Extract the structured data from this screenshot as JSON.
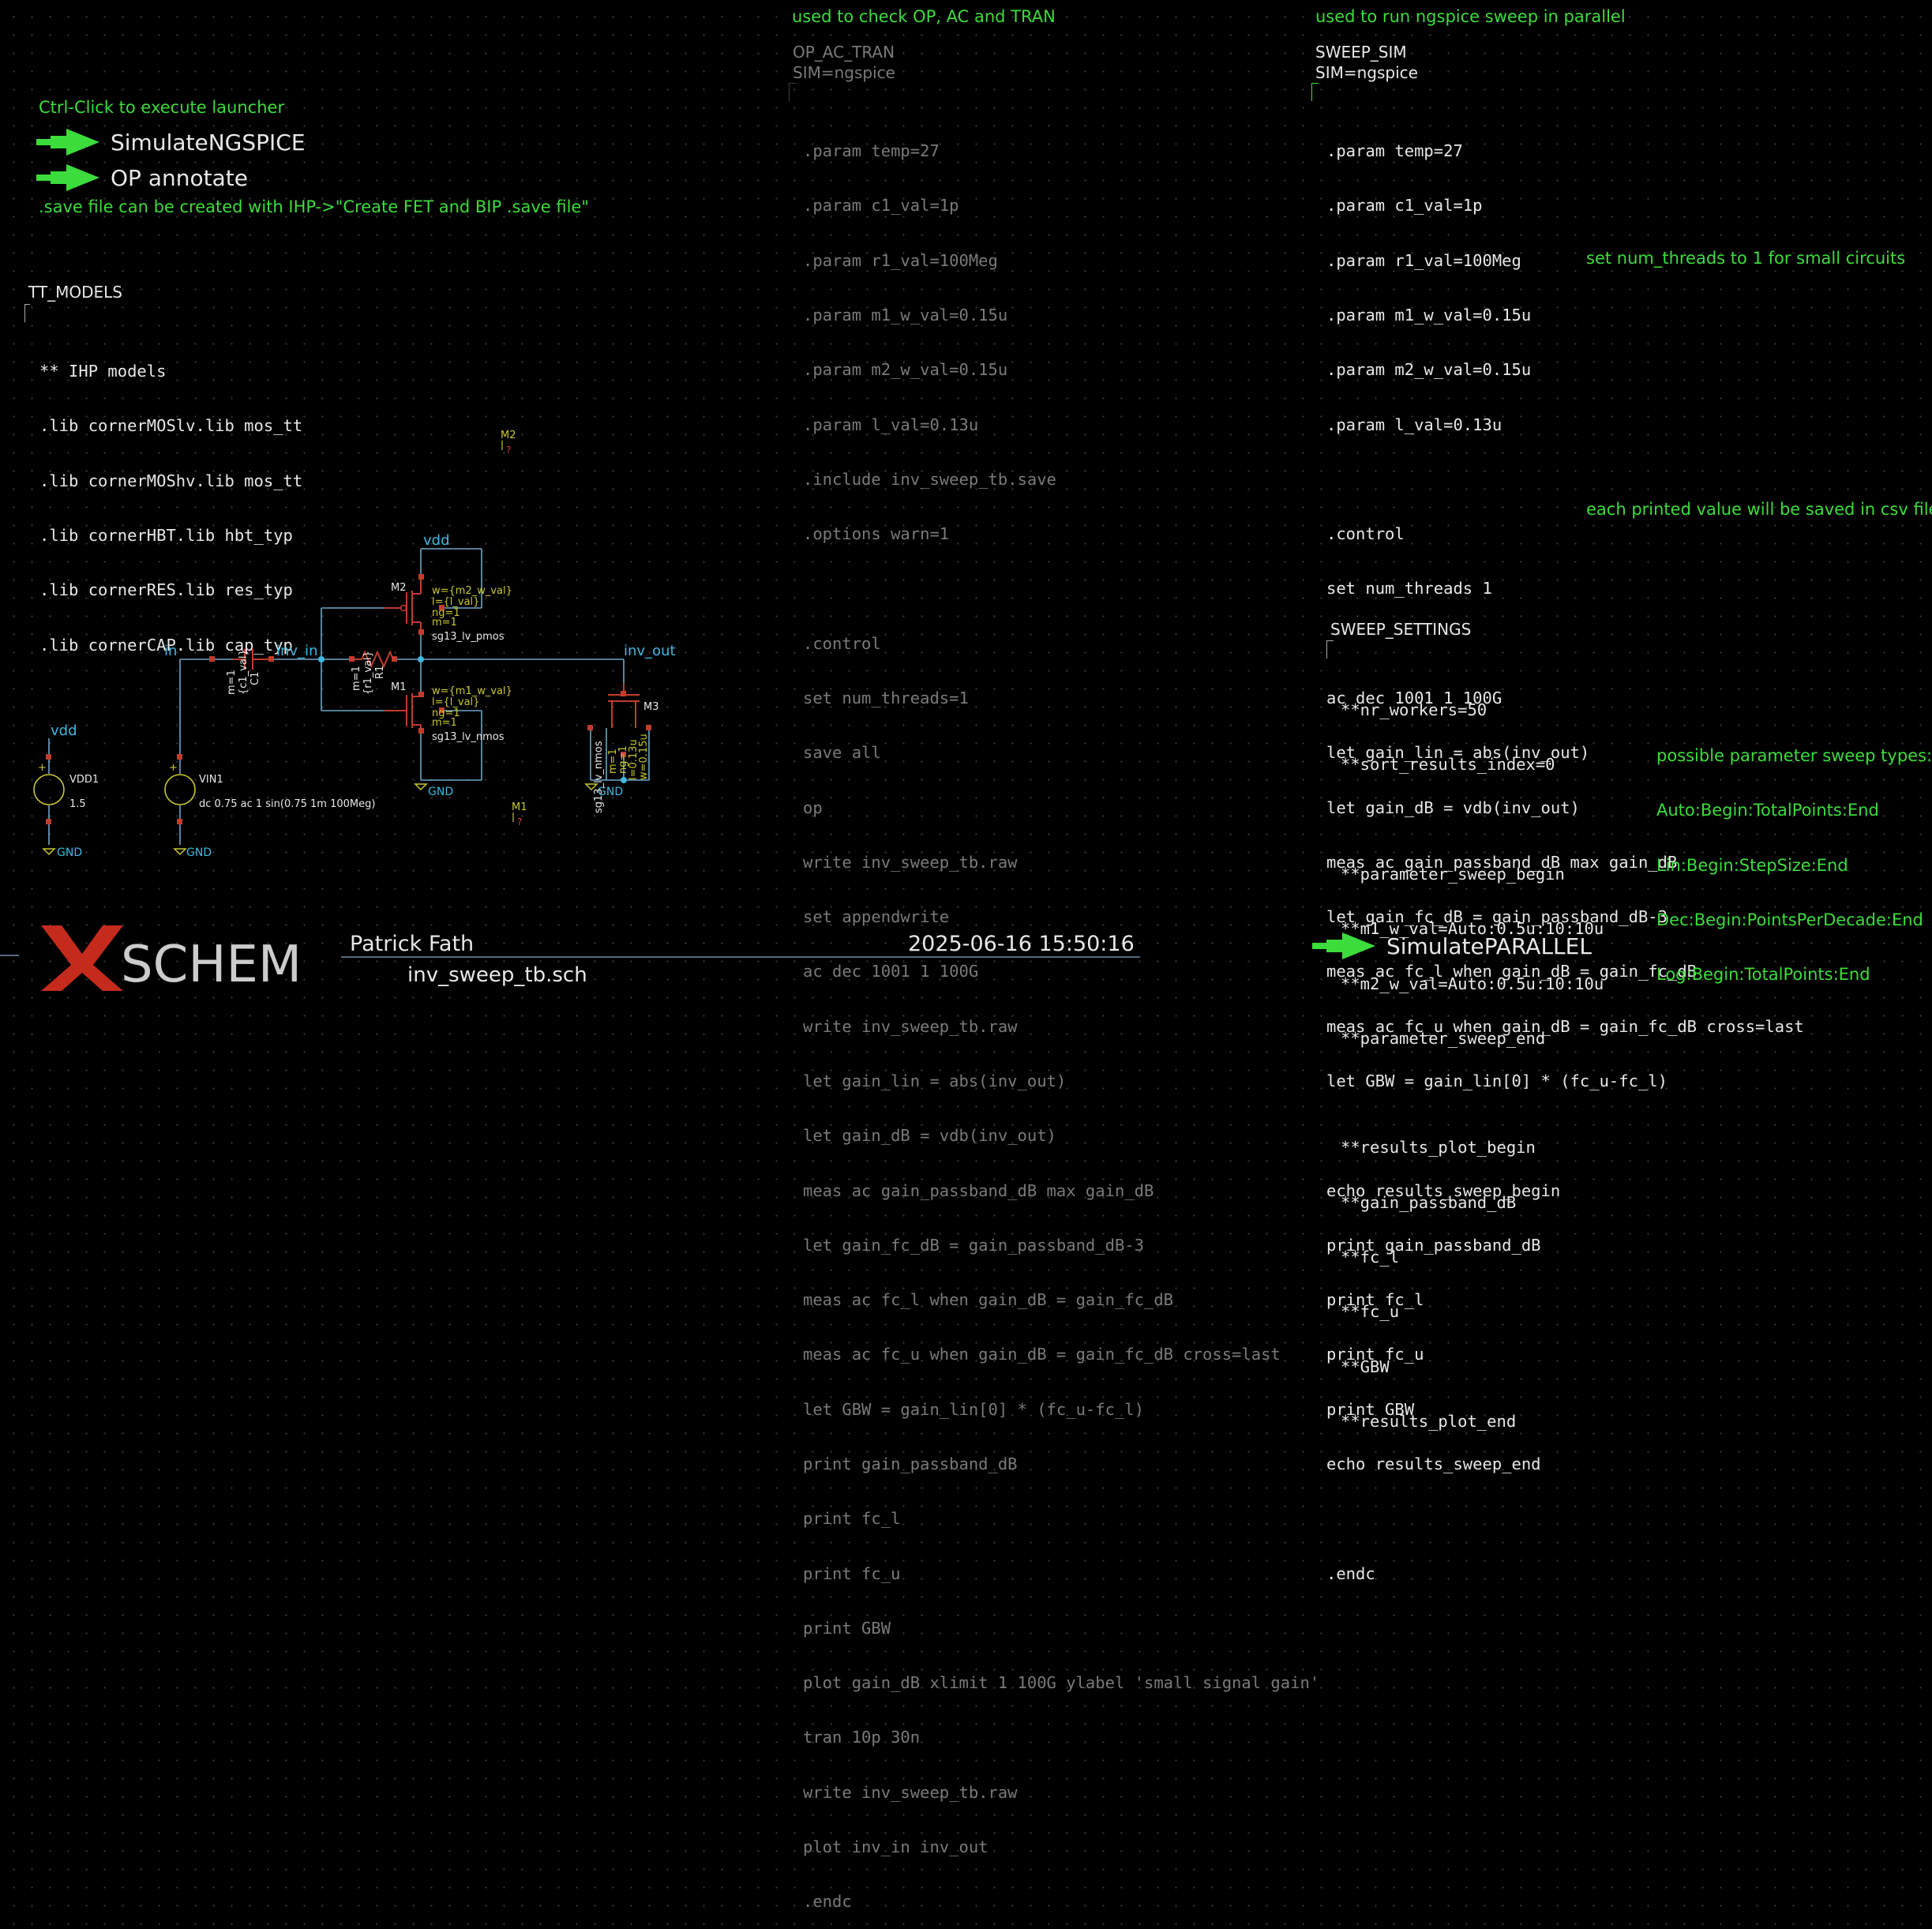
{
  "header_notes": {
    "op_note": "used to check OP, AC and TRAN",
    "sweep_note": "used to run ngspice sweep in parallel"
  },
  "launchers": {
    "hint": "Ctrl-Click to execute launcher",
    "simulate_ngspice": "SimulateNGSPICE",
    "op_annotate": "OP annotate",
    "save_note": ".save file can be created with IHP->\"Create FET and BIP .save file\"",
    "simulate_parallel": "SimulatePARALLEL"
  },
  "tt_models": {
    "title": "TT_MODELS",
    "lines": [
      "** IHP models",
      ".lib cornerMOSlv.lib mos_tt",
      ".lib cornerMOShv.lib mos_tt",
      ".lib cornerHBT.lib hbt_typ",
      ".lib cornerRES.lib res_typ",
      ".lib cornerCAP.lib cap_typ"
    ]
  },
  "op_ac_tran": {
    "title": "OP_AC_TRAN",
    "sim": "SIM=ngspice",
    "lines": [
      ".param temp=27",
      ".param c1_val=1p",
      ".param r1_val=100Meg",
      ".param m1_w_val=0.15u",
      ".param m2_w_val=0.15u",
      ".param l_val=0.13u",
      ".include inv_sweep_tb.save",
      ".options warn=1",
      "",
      ".control",
      "set num_threads=1",
      "save all",
      "op",
      "write inv_sweep_tb.raw",
      "set appendwrite",
      "ac dec 1001 1 100G",
      "write inv_sweep_tb.raw",
      "let gain_lin = abs(inv_out)",
      "let gain_dB = vdb(inv_out)",
      "meas ac gain_passband_dB max gain_dB",
      "let gain_fc_dB = gain_passband_dB-3",
      "meas ac fc_l when gain_dB = gain_fc_dB",
      "meas ac fc_u when gain_dB = gain_fc_dB cross=last",
      "let GBW = gain_lin[0] * (fc_u-fc_l)",
      "print gain_passband_dB",
      "print fc_l",
      "print fc_u",
      "print GBW",
      "plot gain_dB xlimit 1 100G ylabel 'small signal gain'",
      "tran 10p 30n",
      "write inv_sweep_tb.raw",
      "plot inv_in inv_out",
      ".endc"
    ]
  },
  "sweep_sim": {
    "title": "SWEEP_SIM",
    "sim": "SIM=ngspice",
    "lines": [
      ".param temp=27",
      ".param c1_val=1p",
      ".param r1_val=100Meg",
      ".param m1_w_val=0.15u",
      ".param m2_w_val=0.15u",
      ".param l_val=0.13u",
      "",
      ".control",
      "set num_threads 1",
      "",
      "ac dec 1001 1 100G",
      "let gain_lin = abs(inv_out)",
      "let gain_dB = vdb(inv_out)",
      "meas ac gain_passband_dB max gain_dB",
      "let gain_fc_dB = gain_passband_dB-3",
      "meas ac fc_l when gain_dB = gain_fc_dB",
      "meas ac fc_u when gain_dB = gain_fc_dB cross=last",
      "let GBW = gain_lin[0] * (fc_u-fc_l)",
      "",
      "echo results_sweep_begin",
      "print gain_passband_dB",
      "print fc_l",
      "print fc_u",
      "print GBW",
      "echo results_sweep_end",
      "",
      ".endc"
    ],
    "note_threads": "set num_threads to 1 for small circuits",
    "note_csv": "each printed value will be saved in csv file"
  },
  "sweep_settings": {
    "title": "SWEEP_SETTINGS",
    "lines": [
      "**nr_workers=50",
      "**sort_results_index=0",
      "",
      "**parameter_sweep_begin",
      "**m1_w_val=Auto:0.5u:10:10u",
      "**m2_w_val=Auto:0.5u:10:10u",
      "**parameter_sweep_end",
      "",
      "**results_plot_begin",
      "**gain_passband_dB",
      "**fc_l",
      "**fc_u",
      "**GBW",
      "**results_plot_end"
    ],
    "types_note": [
      "possible parameter sweep types:",
      "Auto:Begin:TotalPoints:End",
      "Lin:Begin:StepSize:End",
      "Dec:Begin:PointsPerDecade:End",
      "Log:Begin:TotalPoints:End"
    ]
  },
  "schematic": {
    "nets": {
      "vdd_top": "vdd",
      "in": "in",
      "inv_in": "inv_in",
      "inv_out": "inv_out",
      "vdd_left": "vdd",
      "gnd": "GND"
    },
    "m2": {
      "name": "M2",
      "w": "w={m2_w_val}",
      "l": "l={l_val}",
      "ng": "ng=1",
      "m": "m=1",
      "model": "sg13_lv_pmos"
    },
    "m1": {
      "name": "M1",
      "w": "w={m1_w_val}",
      "l": "l={l_val}",
      "ng": "ng=1",
      "m": "m=1",
      "model": "sg13_lv_nmos"
    },
    "m3": {
      "name": "M3",
      "model": "sg13_lv_nmos",
      "m": "m=1",
      "ng": "ng=1",
      "l": "l=0.13u",
      "w": "w=0.15u"
    },
    "c1": {
      "name": "C1",
      "val": "{c1_val}",
      "m": "m=1"
    },
    "r1": {
      "name": "R1",
      "val": "{r1_val}",
      "m": "m=1"
    },
    "vdd1": {
      "name": "VDD1",
      "value": "1.5"
    },
    "vin1": {
      "name": "VIN1",
      "value": "dc 0.75 ac 1 sin(0.75 1m 100Meg)"
    },
    "floating_m2": {
      "name": "M2",
      "q": "?"
    },
    "floating_m1": {
      "name": "M1",
      "q": "?"
    }
  },
  "title_block": {
    "logo_text": "SCHEM",
    "author": "Patrick Fath",
    "datetime": "2025-06-16  15:50:16",
    "filename": "inv_sweep_tb.sch"
  },
  "colors": {
    "background": "#000000",
    "comment_green": "#3cdc3c",
    "wire": "#6fa6c9",
    "net_label": "#3fb8e0",
    "component": "#c23c2c",
    "attr_text": "#c8c832",
    "logo_red": "#c42b1c"
  }
}
